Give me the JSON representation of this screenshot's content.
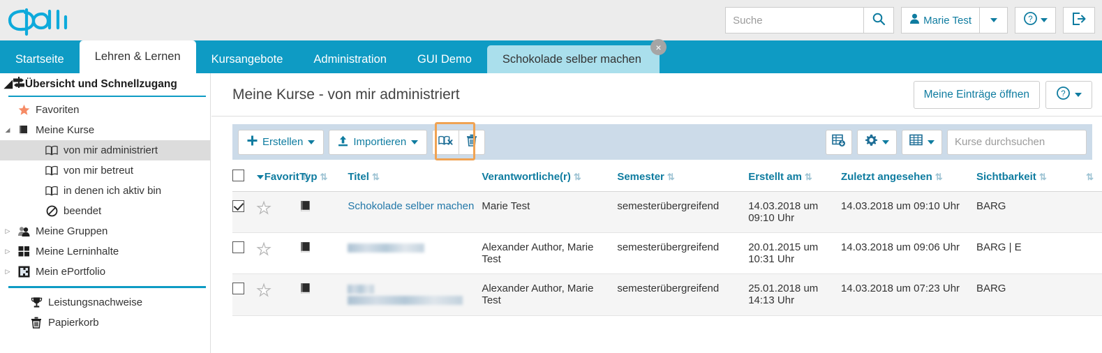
{
  "brand": {
    "logo_text": "OPAL",
    "accent": "#0e9bc4",
    "highlight": "#f0a353"
  },
  "topbar": {
    "search_placeholder": "Suche",
    "search_value": "",
    "search_icon": "search-icon",
    "user_name": "Marie Test",
    "user_icon": "person-icon",
    "help_icon": "question-circle-icon",
    "logout_icon": "logout-icon"
  },
  "nav": {
    "tabs": [
      {
        "label": "Startseite",
        "state": "normal"
      },
      {
        "label": "Lehren & Lernen",
        "state": "active"
      },
      {
        "label": "Kursangebote",
        "state": "normal"
      },
      {
        "label": "Administration",
        "state": "normal"
      },
      {
        "label": "GUI Demo",
        "state": "normal"
      },
      {
        "label": "Schokolade selber machen",
        "state": "course",
        "close_label": "×"
      }
    ]
  },
  "sidebar": {
    "header": {
      "label": "Übersicht und Schnellzugang",
      "icon": "signpost-icon",
      "arrow": "◢"
    },
    "items": [
      {
        "label": "Favoriten",
        "icon": "star-icon",
        "indent": 1,
        "arrow": ""
      },
      {
        "label": "Meine Kurse",
        "icon": "book-icon",
        "indent": 0,
        "arrow": "◢"
      },
      {
        "label": "von mir administriert",
        "icon": "open-book-icon",
        "indent": 2,
        "arrow": "",
        "selected": true
      },
      {
        "label": "von mir betreut",
        "icon": "open-book-icon",
        "indent": 2,
        "arrow": ""
      },
      {
        "label": "in denen ich aktiv bin",
        "icon": "open-book-icon",
        "indent": 2,
        "arrow": ""
      },
      {
        "label": "beendet",
        "icon": "no-entry-icon",
        "indent": 2,
        "arrow": ""
      },
      {
        "label": "Meine Gruppen",
        "icon": "group-icon",
        "indent": 0,
        "arrow": "▷"
      },
      {
        "label": "Meine Lerninhalte",
        "icon": "grid-icon",
        "indent": 0,
        "arrow": "▷"
      },
      {
        "label": "Mein ePortfolio",
        "icon": "puzzle-icon",
        "indent": 0,
        "arrow": "▷"
      }
    ],
    "footer_items": [
      {
        "label": "Leistungsnachweise",
        "icon": "trophy-icon"
      },
      {
        "label": "Papierkorb",
        "icon": "trash-icon"
      }
    ]
  },
  "main": {
    "title": "Meine Kurse - von mir administriert",
    "open_entries_button": "Meine Einträge öffnen",
    "help_icon": "question-circle-icon"
  },
  "toolbar": {
    "create_label": "Erstellen",
    "create_icon": "plus-icon",
    "import_label": "Importieren",
    "import_icon": "upload-icon",
    "close_course_icon": "book-x-icon",
    "delete_icon": "trash-icon",
    "export_icon": "table-download-icon",
    "settings_icon": "gear-icon",
    "columns_icon": "table-icon",
    "search_placeholder": "Kurse durchsuchen",
    "search_value": ""
  },
  "table": {
    "select_all_checked": false,
    "columns": [
      {
        "key": "checkbox",
        "label": "",
        "sortable": false
      },
      {
        "key": "favorit",
        "label": "Favorit",
        "sortable": true,
        "prefix_caret": true
      },
      {
        "key": "typ",
        "label": "Typ",
        "sortable": true
      },
      {
        "key": "titel",
        "label": "Titel",
        "sortable": true
      },
      {
        "key": "verantwortliche",
        "label": "Verantwortliche(r)",
        "sortable": true
      },
      {
        "key": "semester",
        "label": "Semester",
        "sortable": true
      },
      {
        "key": "erstellt",
        "label": "Erstellt am",
        "sortable": true
      },
      {
        "key": "zuletzt",
        "label": "Zuletzt angesehen",
        "sortable": true
      },
      {
        "key": "sichtbarkeit",
        "label": "Sichtbarkeit",
        "sortable": true
      },
      {
        "key": "extra",
        "label": "",
        "sortable": true
      }
    ],
    "sort_icon": "⇅",
    "rows": [
      {
        "checked": true,
        "favorite": false,
        "type_icon": "book-icon",
        "title": "Schokolade selber machen",
        "title_redacted": false,
        "responsible": "Marie Test",
        "semester": "semesterübergreifend",
        "created": "14.03.2018 um 09:10 Uhr",
        "last_viewed": "14.03.2018 um 09:10 Uhr",
        "visibility": "BARG"
      },
      {
        "checked": false,
        "favorite": false,
        "type_icon": "book-icon",
        "title": "",
        "title_redacted": true,
        "redacted_lines": [
          110
        ],
        "responsible": "Alexander Author, Marie Test",
        "semester": "semesterübergreifend",
        "created": "20.01.2015 um 10:31 Uhr",
        "last_viewed": "14.03.2018 um 09:06 Uhr",
        "visibility": "BARG | E"
      },
      {
        "checked": false,
        "favorite": false,
        "type_icon": "book-icon",
        "title": "",
        "title_redacted": true,
        "redacted_lines": [
          38,
          165
        ],
        "responsible": "Alexander Author, Marie Test",
        "semester": "semesterübergreifend",
        "created": "25.01.2018 um 14:13 Uhr",
        "last_viewed": "14.03.2018 um 07:23 Uhr",
        "visibility": "BARG"
      }
    ]
  }
}
